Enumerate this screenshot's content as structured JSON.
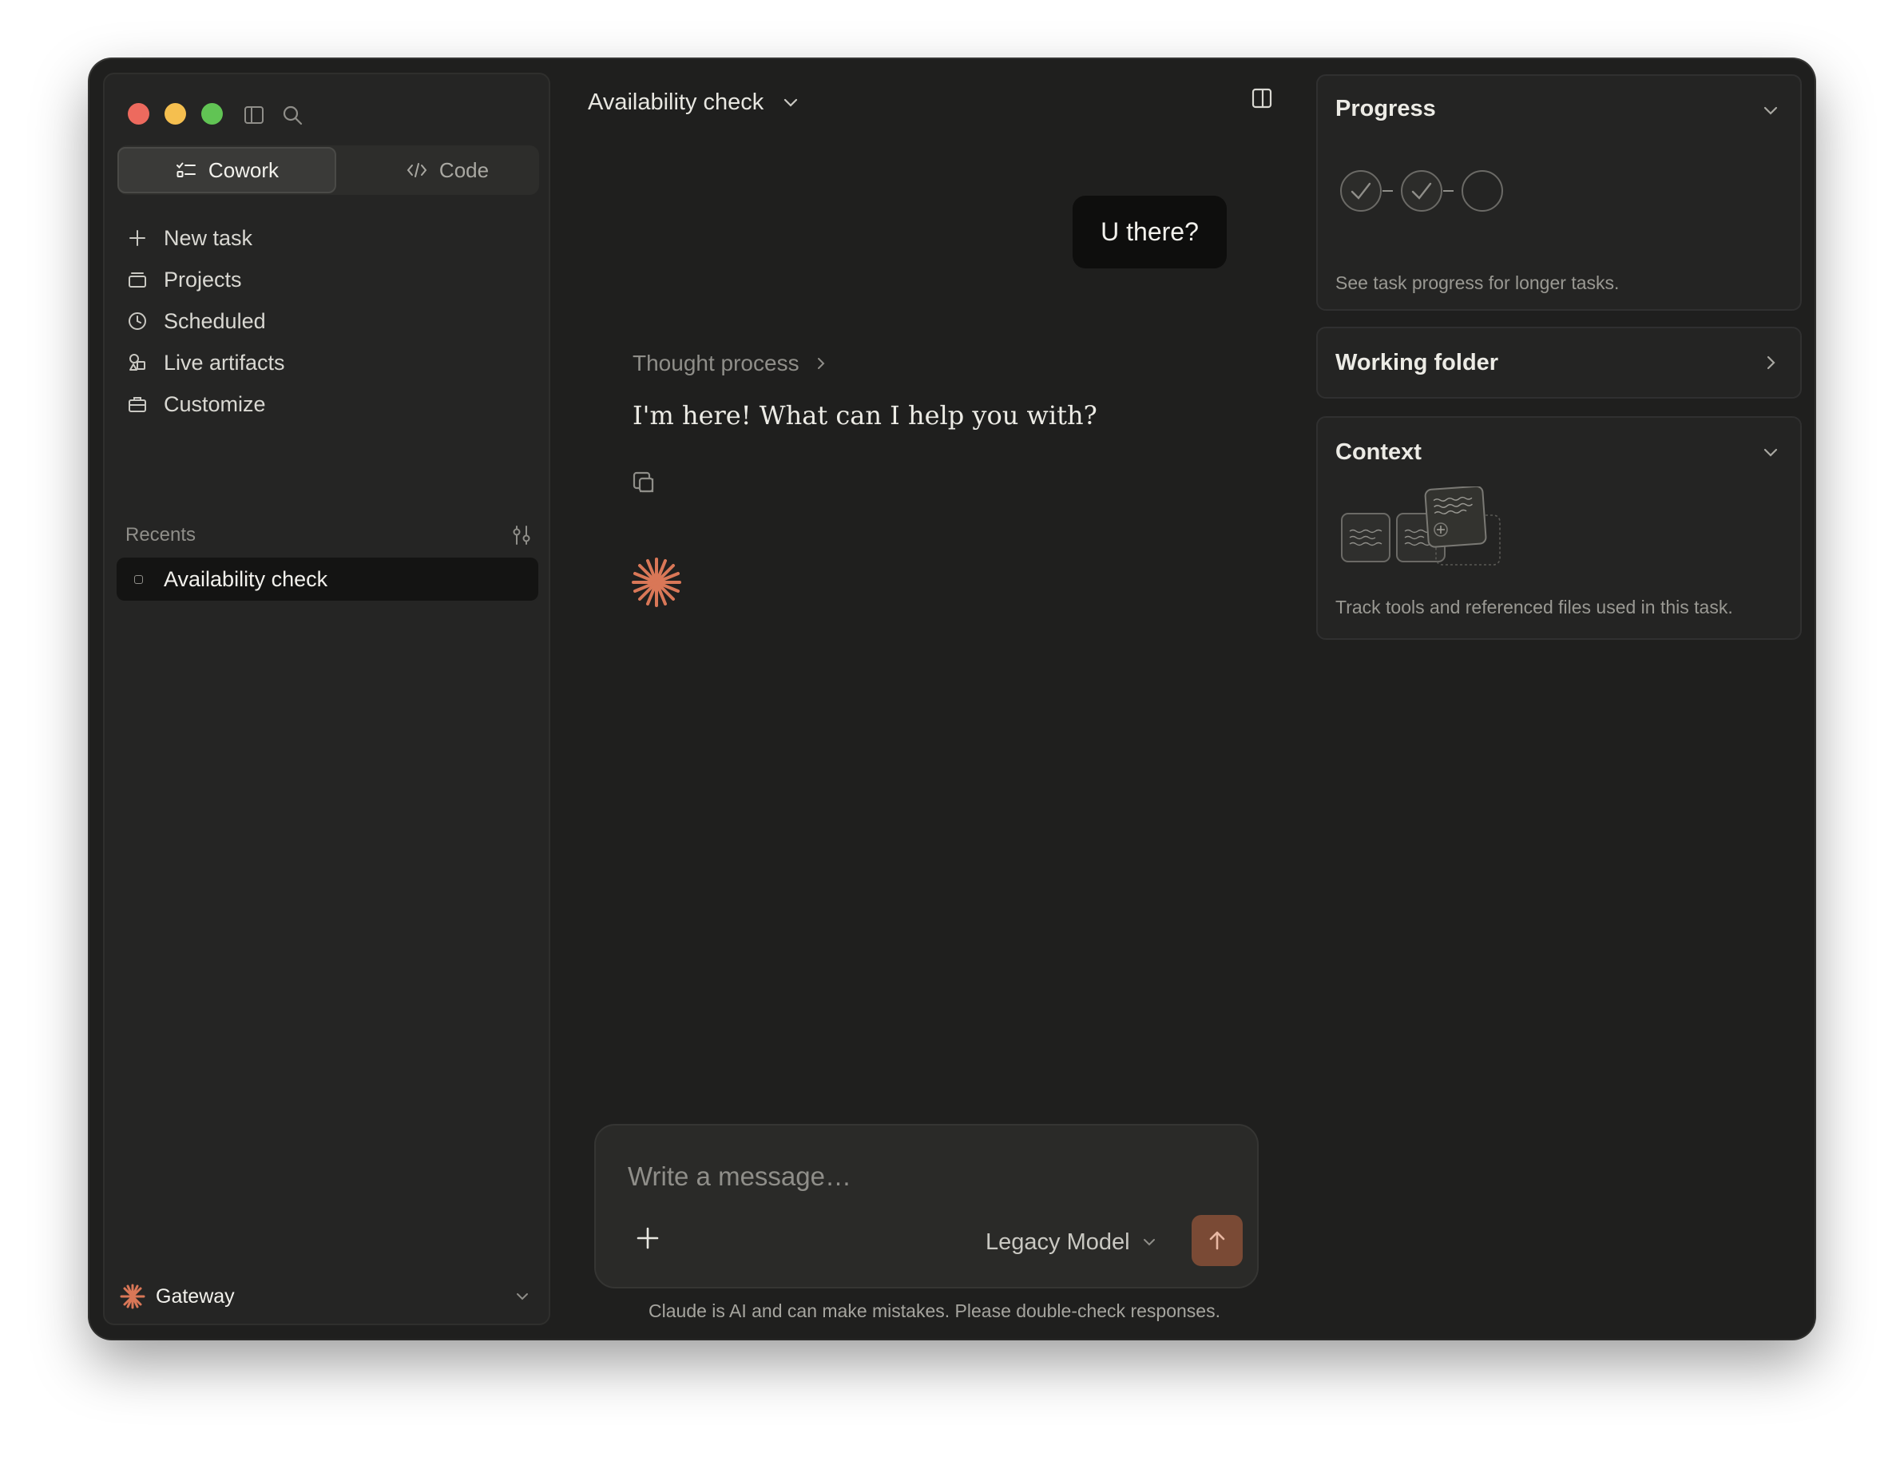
{
  "sidebar": {
    "modes": [
      {
        "label": "Cowork",
        "icon": "tasks-icon",
        "active": true
      },
      {
        "label": "Code",
        "icon": "code-icon",
        "active": false
      }
    ],
    "nav": [
      {
        "label": "New task",
        "icon": "plus-icon"
      },
      {
        "label": "Projects",
        "icon": "projects-icon"
      },
      {
        "label": "Scheduled",
        "icon": "clock-icon"
      },
      {
        "label": "Live artifacts",
        "icon": "shapes-icon"
      },
      {
        "label": "Customize",
        "icon": "briefcase-icon"
      }
    ],
    "recents_label": "Recents",
    "recents": [
      {
        "label": "Availability check"
      }
    ],
    "account": {
      "label": "Gateway"
    }
  },
  "main": {
    "title": "Availability check",
    "user_message": "U there?",
    "thought_label": "Thought process",
    "assistant_message": "I'm here! What can I help you with?",
    "composer": {
      "placeholder": "Write a message…",
      "model": "Legacy Model"
    },
    "disclaimer": "Claude is AI and can make mistakes. Please double-check responses."
  },
  "panel": {
    "progress": {
      "title": "Progress",
      "description": "See task progress for longer tasks."
    },
    "working_folder": {
      "title": "Working folder"
    },
    "context": {
      "title": "Context",
      "description": "Track tools and referenced files used in this task."
    }
  },
  "colors": {
    "accent": "#d97757",
    "send_button": "#7a4a35",
    "window_bg": "#1f1f1e",
    "sidebar_bg": "#252524"
  }
}
